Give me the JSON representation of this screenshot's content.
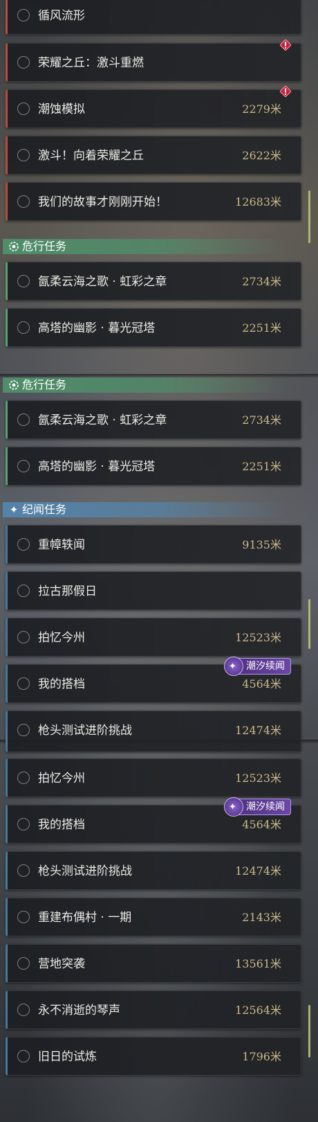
{
  "panel1": {
    "items": [
      {
        "name": "循风流形",
        "distance": ""
      },
      {
        "name": "荣耀之丘：激斗重燃",
        "distance": ""
      },
      {
        "name": "潮蚀模拟",
        "distance": "2279米"
      },
      {
        "name": "激斗！向着荣耀之丘",
        "distance": "2622米"
      },
      {
        "name": "我们的故事才刚刚开始！",
        "distance": "12683米"
      }
    ],
    "danger_header": "危行任务",
    "danger_items": [
      {
        "name": "氤柔云海之歌 · 虹彩之章",
        "distance": "2734米"
      },
      {
        "name": "高塔的幽影 · 暮光冠塔",
        "distance": "2251米"
      }
    ]
  },
  "panel2": {
    "danger_header": "危行任务",
    "danger_items": [
      {
        "name": "氤柔云海之歌 · 虹彩之章",
        "distance": "2734米"
      },
      {
        "name": "高塔的幽影 · 暮光冠塔",
        "distance": "2251米"
      }
    ],
    "chronicle_header": "纪闻任务",
    "chronicle_items": [
      {
        "name": "重幛轶闻",
        "distance": "9135米"
      },
      {
        "name": "拉古那假日",
        "distance": ""
      },
      {
        "name": "拍忆今州",
        "distance": "12523米"
      },
      {
        "name": "我的搭档",
        "distance": "4564米",
        "tag": "潮汐续闻"
      },
      {
        "name": "枪头测试进阶挑战",
        "distance": "12474米"
      }
    ]
  },
  "panel3": {
    "items": [
      {
        "name": "拉古那假日",
        "distance": ""
      },
      {
        "name": "拍忆今州",
        "distance": "12523米"
      },
      {
        "name": "我的搭档",
        "distance": "4564米",
        "tag": "潮汐续闻"
      },
      {
        "name": "枪头测试进阶挑战",
        "distance": "12474米"
      },
      {
        "name": "重建布偶村 · 一期",
        "distance": "2143米"
      },
      {
        "name": "营地突袭",
        "distance": "13561米"
      },
      {
        "name": "永不消逝的琴声",
        "distance": "12564米"
      },
      {
        "name": "旧日的试炼",
        "distance": "1796米"
      }
    ]
  },
  "colors": {
    "main_quest_accent": "#b55040",
    "danger_accent": "#4f8e6a",
    "chronicle_accent": "#5583a8",
    "distance_text": "#cbb889",
    "tidal_tag": "#6b47a6"
  },
  "icons": {
    "danger_header": "eye-gear-icon",
    "chronicle_header": "sparkle-icon",
    "alert": "red-diamond-alert-icon",
    "tag": "tidal-sparkle-icon"
  }
}
